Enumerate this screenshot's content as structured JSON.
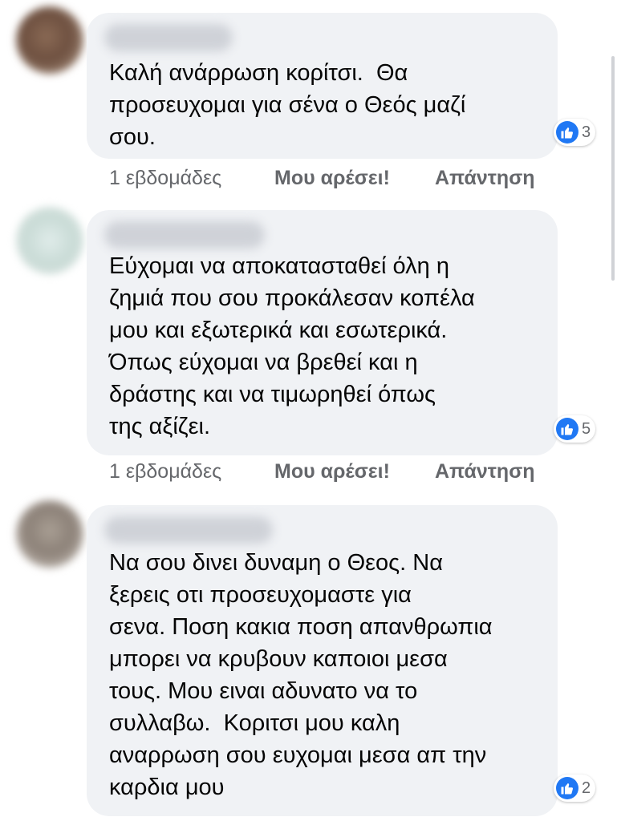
{
  "comments": [
    {
      "text": "Καλή ανάρρωση κορίτσι.  Θα\nπροσευχομαι για σένα ο Θεός μαζί\nσου.",
      "reactions": {
        "icon": "like-icon",
        "count": "3"
      },
      "actions": {
        "time": "1 εβδομάδες",
        "like": "Μου αρέσει!",
        "reply": "Απάντηση"
      }
    },
    {
      "text": "Εύχομαι να αποκατασταθεί όλη η\nζημιά που σου προκάλεσαν κοπέλα\nμου και εξωτερικά και εσωτερικά.\nΌπως εύχομαι να βρεθεί και η\nδράστης και να τιμωρηθεί όπως\nτης αξίζει.",
      "reactions": {
        "icon": "like-icon",
        "count": "5"
      },
      "actions": {
        "time": "1 εβδομάδες",
        "like": "Μου αρέσει!",
        "reply": "Απάντηση"
      }
    },
    {
      "text": "Να σου δινει δυναμη ο Θεος. Να\nξερεις οτι προσευχομαστε για\nσενα. Ποση κακια ποση απανθρωπια\nμπορει να κρυβουν καποιοι μεσα\nτους. Μου ειναι αδυνατο να το\nσυλλαβω.  Κοριτσι μου καλη\nαναρρωση σου ευχομαι μεσα απ την\nκαρδια μου",
      "reactions": {
        "icon": "like-icon",
        "count": "2"
      }
    }
  ],
  "colors": {
    "bubble": "#f0f2f5",
    "text": "#050505",
    "secondary_text": "#65676b",
    "like_blue": "#2078f4"
  }
}
